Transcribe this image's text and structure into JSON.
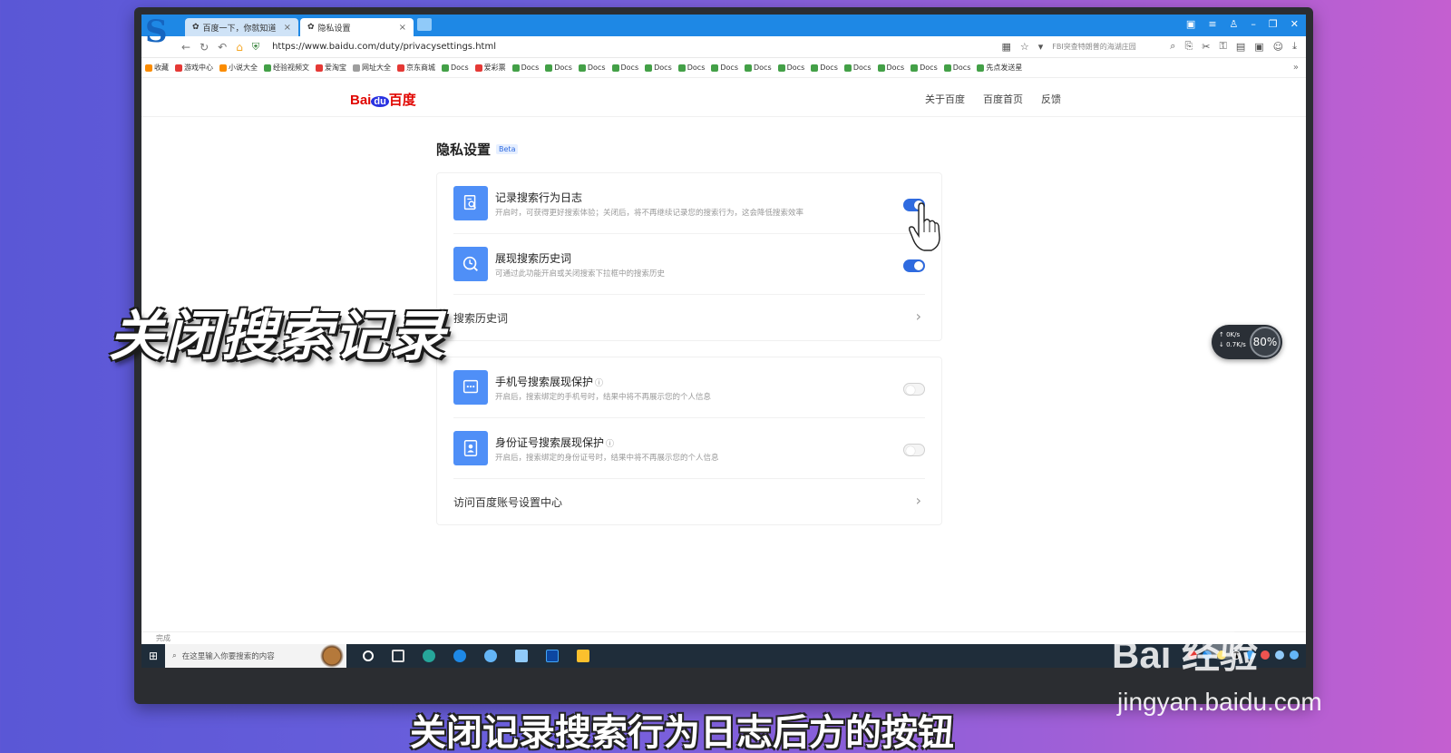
{
  "browser": {
    "tabs": [
      {
        "label": "百度一下，你就知道",
        "active": false
      },
      {
        "label": "隐私设置",
        "active": true
      }
    ],
    "url": "https://www.baidu.com/duty/privacysettings.html",
    "search_hint": "FBI突查特朗普的海湖庄园",
    "bookmarks": [
      "收藏",
      "游戏中心",
      "小说大全",
      "经验视频文",
      "爱淘宝",
      "网址大全",
      "京东商城",
      "Docs",
      "爱彩票",
      "Docs",
      "Docs",
      "Docs",
      "Docs",
      "Docs",
      "Docs",
      "Docs",
      "Docs",
      "Docs",
      "Docs",
      "Docs",
      "Docs",
      "Docs",
      "Docs",
      "先点发送星"
    ],
    "status_text": "完成"
  },
  "page": {
    "logo_bai": "Bai",
    "logo_du": "du",
    "logo_cn": "百度",
    "header_links": [
      "关于百度",
      "百度首页",
      "反馈"
    ],
    "title": "隐私设置",
    "beta": "Beta"
  },
  "settings": {
    "card1": [
      {
        "title": "记录搜索行为日志",
        "desc": "开启时，可获得更好搜索体验；关闭后，将不再继续记录您的搜索行为，这会降低搜索效率",
        "enabled": true,
        "icon": "document-search-icon"
      },
      {
        "title": "展现搜索历史词",
        "desc": "可通过此功能开启或关闭搜索下拉框中的搜索历史",
        "enabled": true,
        "icon": "clock-search-icon"
      }
    ],
    "card1_link": "搜索历史词",
    "card2": [
      {
        "title": "手机号搜索展现保护",
        "desc": "开启后，搜索绑定的手机号时，结果中将不再展示您的个人信息",
        "enabled": false,
        "icon": "phone-icon"
      },
      {
        "title": "身份证号搜索展现保护",
        "desc": "开启后，搜索绑定的身份证号时，结果中将不再展示您的个人信息",
        "enabled": false,
        "icon": "id-card-icon"
      }
    ],
    "card2_link": "访问百度账号设置中心"
  },
  "taskbar": {
    "search_placeholder": "在这里输入你要搜索的内容"
  },
  "net_widget": {
    "up": "0K/s",
    "down": "0.7K/s",
    "percent": "80%"
  },
  "overlay": {
    "big_caption": "关闭搜索记录",
    "subtitle": "关闭记录搜索行为日志后方的按钮",
    "watermark_logo": "Bai 经验",
    "watermark_url": "jingyan.baidu.com"
  },
  "colors": {
    "accent": "#2f6be0",
    "icon_bg": "#4f8ff7",
    "baidu_red": "#e10601"
  }
}
